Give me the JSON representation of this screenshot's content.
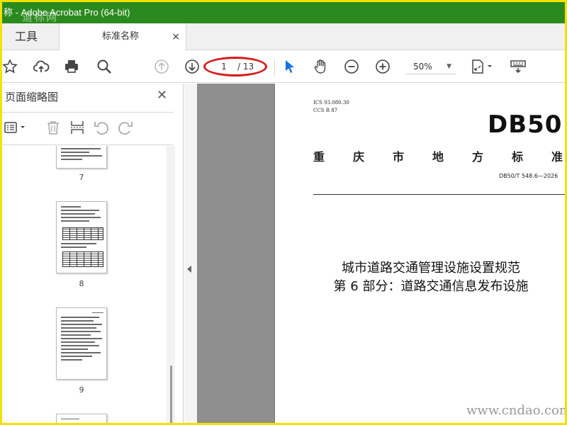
{
  "window": {
    "title": "称 - Adobe Acrobat Pro (64-bit)",
    "watermark_top": "道标网"
  },
  "tabs": {
    "tools_label": "工具",
    "doc_label": "标准名称",
    "close_glyph": "×"
  },
  "toolbar": {
    "page_current": "1",
    "page_total": "/ 13",
    "zoom": "50%",
    "icons": [
      "star-icon",
      "cloud-upload-icon",
      "print-icon",
      "search-icon",
      "page-up-icon",
      "page-down-icon",
      "select-cursor-icon",
      "hand-icon",
      "zoom-out-icon",
      "zoom-in-icon",
      "fit-page-icon",
      "keyboard-icon"
    ]
  },
  "left_panel": {
    "title": "页面缩略图",
    "close_glyph": "✕",
    "thumbnails": [
      {
        "page": "7"
      },
      {
        "page": "8"
      },
      {
        "page": "9"
      }
    ]
  },
  "document": {
    "ics": "ICS 93.080.30",
    "ccs": "CCS R 87",
    "db_label": "DB50",
    "standard_title": "重庆市地方标准",
    "standard_number": "DB50/T 548.6—2026",
    "title_line1": "城市道路交通管理设施设置规范",
    "title_line2": "第 6 部分：道路交通信息发布设施"
  },
  "watermark_bottom": "www.cndao.com",
  "colors": {
    "titlebar": "#2b8a1e",
    "frame": "#f5e100",
    "highlight_ellipse": "#d81a1a",
    "accent_cursor": "#1473e6"
  }
}
